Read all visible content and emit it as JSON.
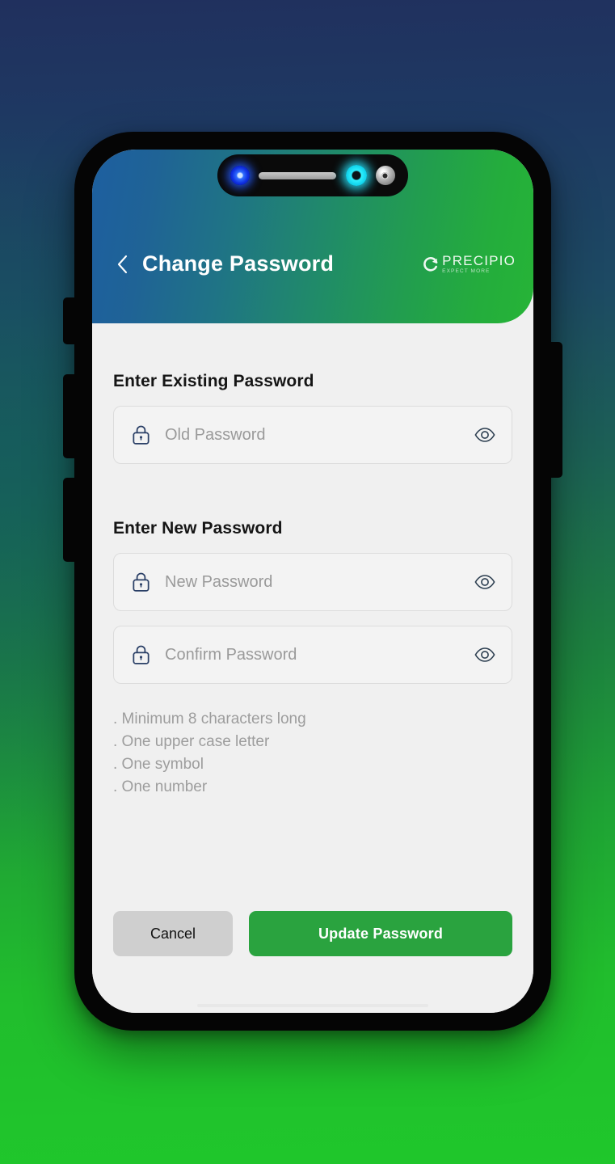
{
  "background": {
    "top_color": "#20305e",
    "bottom_color": "#1fc72b"
  },
  "device": {
    "frame_color": "#050505",
    "notch": {
      "front_camera_icon": "camera-dot-blue",
      "earpiece_speaker": "speaker-grille",
      "sensor_icon": "sensor-ring-cyan",
      "lens_icon": "camera-lens-gray"
    },
    "buttons": {
      "silent_switch": "silent-switch",
      "volume_up": "volume-up-button",
      "volume_down": "volume-down-button",
      "power": "power-button"
    },
    "home_indicator": "home-indicator"
  },
  "header": {
    "title": "Change Password",
    "back_icon": "chevron-left-icon",
    "gradient_from": "#1d5fa0",
    "gradient_to": "#26b437",
    "brand": {
      "mark_icon": "precipio-swoosh-icon",
      "name": "PRECIPIO",
      "tagline": "EXPECT MORE"
    }
  },
  "form": {
    "existing_section": {
      "label": "Enter Existing Password",
      "field": {
        "lock_icon": "lock-icon",
        "placeholder": "Old Password",
        "value": "",
        "toggle_icon": "eye-icon"
      }
    },
    "new_section": {
      "label": "Enter New Password",
      "new_field": {
        "lock_icon": "lock-icon",
        "placeholder": "New Password",
        "value": "",
        "toggle_icon": "eye-icon"
      },
      "confirm_field": {
        "lock_icon": "lock-icon",
        "placeholder": "Confirm Password",
        "value": "",
        "toggle_icon": "eye-icon"
      }
    },
    "requirements": [
      ". Minimum 8 characters long",
      ". One upper case letter",
      ". One symbol",
      ". One number"
    ]
  },
  "actions": {
    "cancel_label": "Cancel",
    "update_label": "Update Password",
    "update_color": "#2aa33f",
    "cancel_color": "#cfcfcf"
  }
}
